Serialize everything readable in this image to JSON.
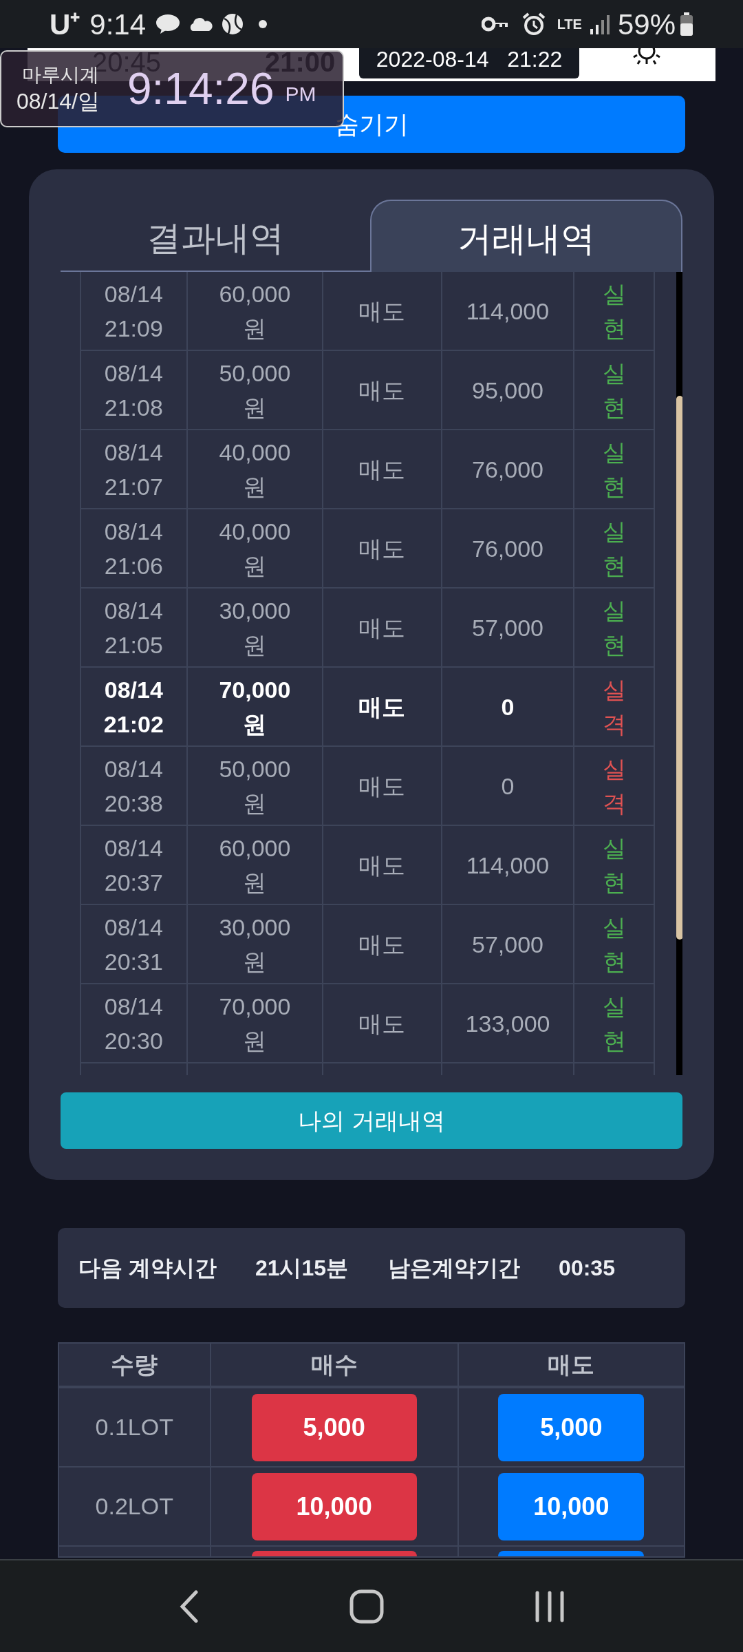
{
  "status_bar": {
    "carrier": "U⁺",
    "time": "9:14",
    "battery": "59%",
    "network": "LTE"
  },
  "top_bar": {
    "time_1": "20:45",
    "time_2": "21:00",
    "datetime": "2022-08-14   21:22"
  },
  "clock_widget": {
    "title": "마루시계",
    "date": "08/14/일",
    "time": "9:14:26",
    "ampm": "PM"
  },
  "hide_button": "숨기기",
  "tabs": [
    {
      "label": "결과내역",
      "selected": false
    },
    {
      "label": "거래내역",
      "selected": true
    }
  ],
  "trades": [
    {
      "date": "08/14",
      "time": "21:09",
      "amount": "60,000",
      "unit": "원",
      "type": "매도",
      "value": "114,000",
      "result": "실현",
      "color": "#4caf50",
      "emphasized": false
    },
    {
      "date": "08/14",
      "time": "21:08",
      "amount": "50,000",
      "unit": "원",
      "type": "매도",
      "value": "95,000",
      "result": "실현",
      "color": "#4caf50",
      "emphasized": false
    },
    {
      "date": "08/14",
      "time": "21:07",
      "amount": "40,000",
      "unit": "원",
      "type": "매도",
      "value": "76,000",
      "result": "실현",
      "color": "#4caf50",
      "emphasized": false
    },
    {
      "date": "08/14",
      "time": "21:06",
      "amount": "40,000",
      "unit": "원",
      "type": "매도",
      "value": "76,000",
      "result": "실현",
      "color": "#4caf50",
      "emphasized": false
    },
    {
      "date": "08/14",
      "time": "21:05",
      "amount": "30,000",
      "unit": "원",
      "type": "매도",
      "value": "57,000",
      "result": "실현",
      "color": "#4caf50",
      "emphasized": false
    },
    {
      "date": "08/14",
      "time": "21:02",
      "amount": "70,000",
      "unit": "원",
      "type": "매도",
      "value": "0",
      "result": "실격",
      "color": "#e05252",
      "emphasized": true
    },
    {
      "date": "08/14",
      "time": "20:38",
      "amount": "50,000",
      "unit": "원",
      "type": "매도",
      "value": "0",
      "result": "실격",
      "color": "#e05252",
      "emphasized": false
    },
    {
      "date": "08/14",
      "time": "20:37",
      "amount": "60,000",
      "unit": "원",
      "type": "매도",
      "value": "114,000",
      "result": "실현",
      "color": "#4caf50",
      "emphasized": false
    },
    {
      "date": "08/14",
      "time": "20:31",
      "amount": "30,000",
      "unit": "원",
      "type": "매도",
      "value": "57,000",
      "result": "실현",
      "color": "#4caf50",
      "emphasized": false
    },
    {
      "date": "08/14",
      "time": "20:30",
      "amount": "70,000",
      "unit": "원",
      "type": "매도",
      "value": "133,000",
      "result": "실현",
      "color": "#4caf50",
      "emphasized": false
    }
  ],
  "my_trades_button": "나의 거래내역",
  "info": [
    {
      "label": "다음 계약시간",
      "value": "21시15분"
    },
    {
      "label": "남은계약기간",
      "value": "00:35"
    }
  ],
  "lot_table": {
    "columns": [
      "수량",
      "매수",
      "매도"
    ],
    "rows": [
      {
        "qty": "0.1LOT",
        "buy": "5,000",
        "sell": "5,000"
      },
      {
        "qty": "0.2LOT",
        "buy": "10,000",
        "sell": "10,000"
      }
    ]
  }
}
